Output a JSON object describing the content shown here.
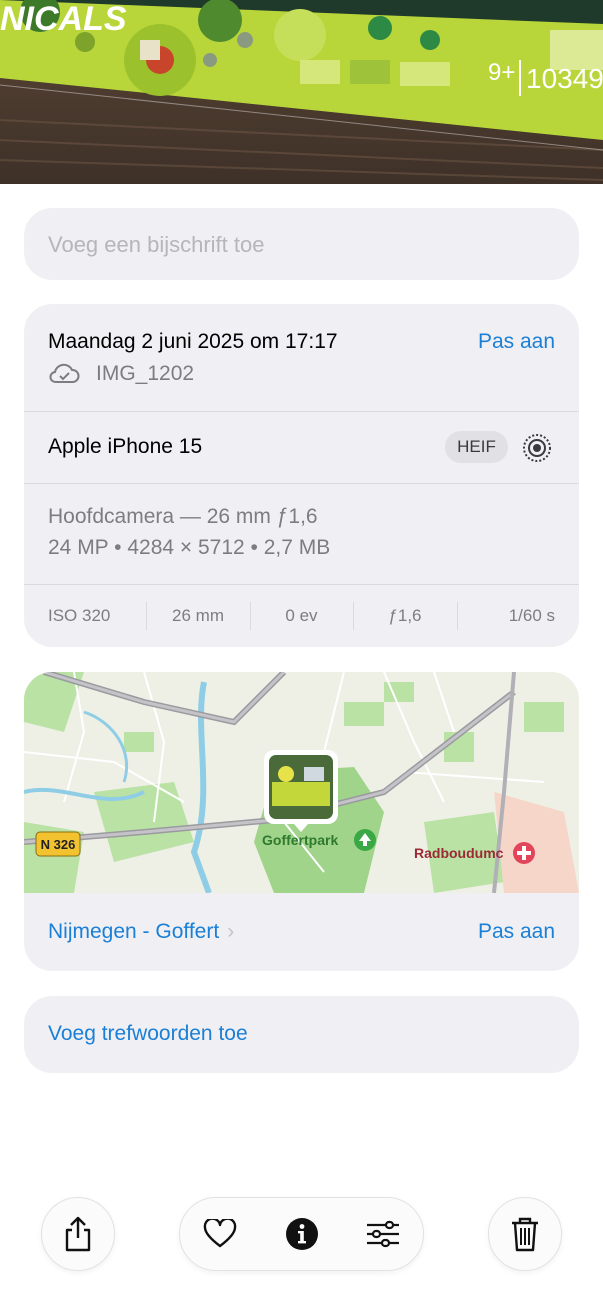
{
  "photo": {
    "brand_text": "NICALS",
    "age_label": "9+",
    "set_number": "10349"
  },
  "caption": {
    "placeholder": "Voeg een bijschrift toe"
  },
  "info": {
    "datetime": "Maandag 2 juni 2025 om 17:17",
    "edit_label": "Pas aan",
    "filename": "IMG_1202",
    "device": "Apple iPhone 15",
    "format_badge": "HEIF",
    "camera": "Hoofdcamera — 26 mm ƒ1,6",
    "file_details": "24 MP • 4284 × 5712 • 2,7 MB",
    "specs": [
      "ISO 320",
      "26 mm",
      "0 ev",
      "ƒ1,6",
      "1/60 s"
    ]
  },
  "map": {
    "road_label": "N 326",
    "park_label": "Goffertpark",
    "hospital_label": "Radboudumc",
    "location": "Nijmegen - Goffert",
    "edit_label": "Pas aan"
  },
  "keywords": {
    "label": "Voeg trefwoorden toe"
  },
  "colors": {
    "accent": "#1a7fd6",
    "card_bg": "#f0f0f4",
    "secondary_text": "#7c7c82"
  },
  "toolbar": {
    "icons": [
      "share-icon",
      "heart-icon",
      "info-icon",
      "adjust-icon",
      "trash-icon"
    ]
  }
}
